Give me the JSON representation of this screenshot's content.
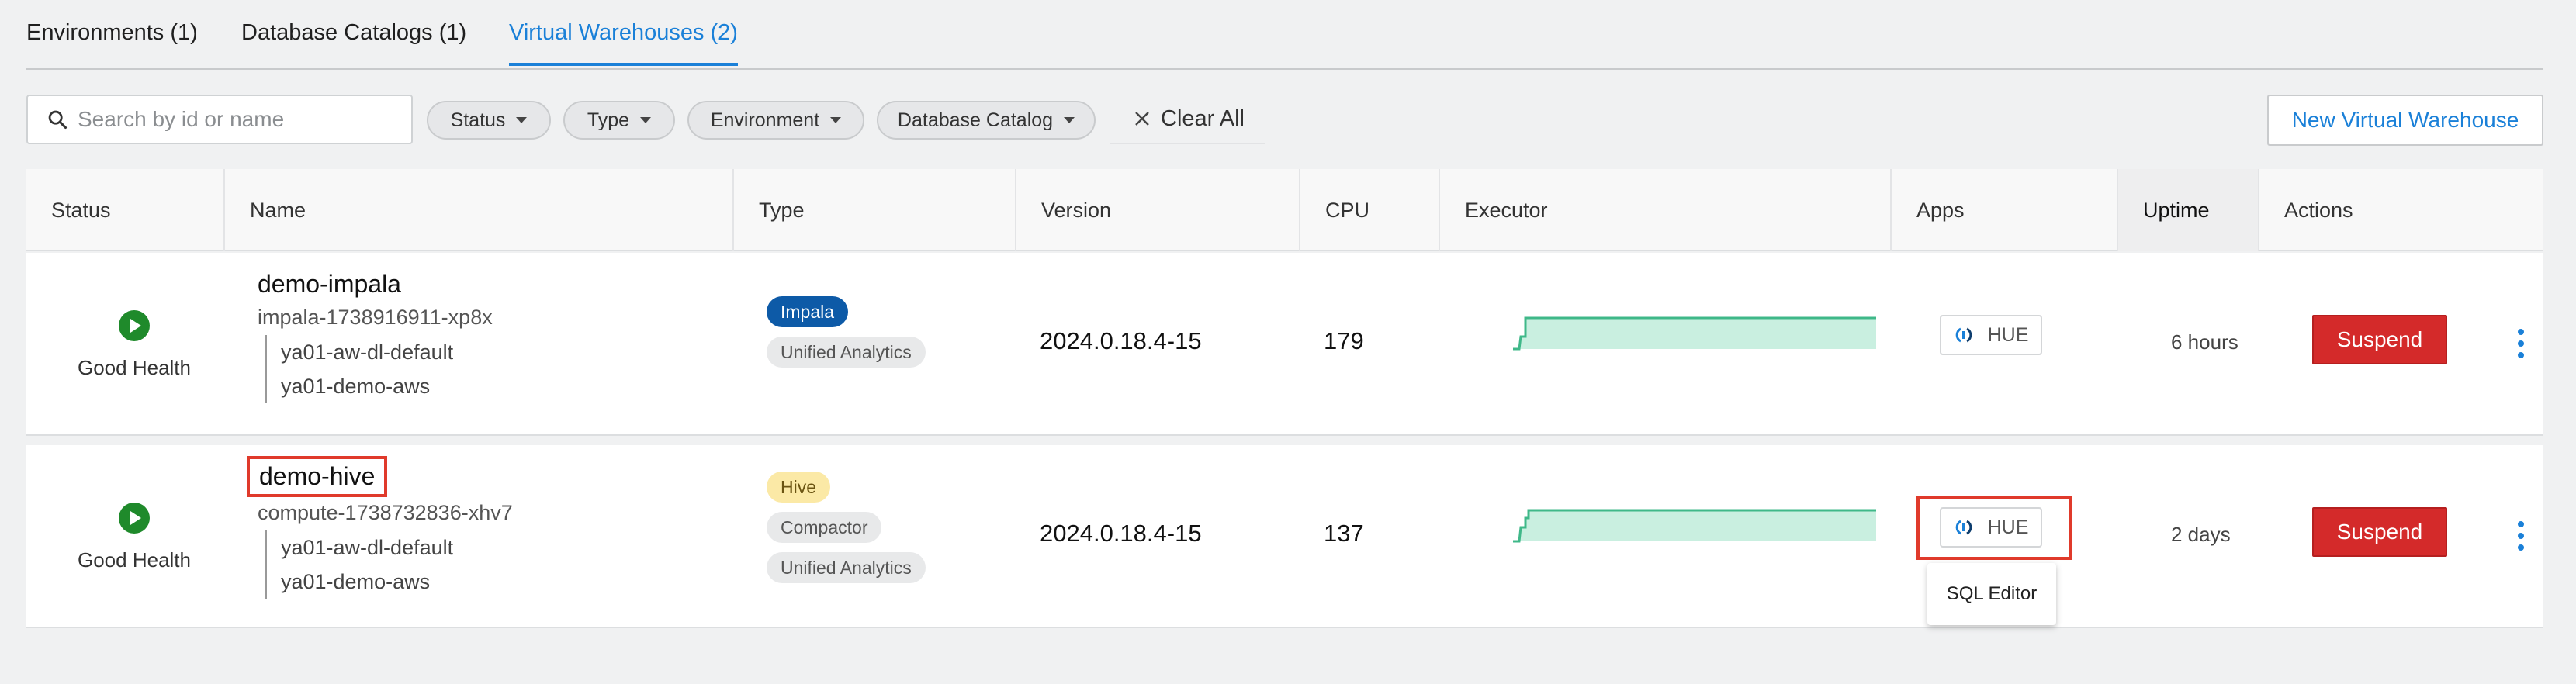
{
  "tabs": [
    {
      "label": "Environments (1)",
      "active": false
    },
    {
      "label": "Database Catalogs (1)",
      "active": false
    },
    {
      "label": "Virtual Warehouses (2)",
      "active": true
    }
  ],
  "toolbar": {
    "search_placeholder": "Search by id or name",
    "filters": [
      "Status",
      "Type",
      "Environment",
      "Database Catalog"
    ],
    "clear_all_label": "Clear All",
    "new_button_label": "New Virtual Warehouse"
  },
  "table": {
    "columns": [
      "Status",
      "Name",
      "Type",
      "Version",
      "CPU",
      "Executor",
      "Apps",
      "Uptime",
      "Actions"
    ],
    "rows": [
      {
        "status": "Good Health",
        "name": "demo-impala",
        "id": "impala-1738916911-xp8x",
        "environment": "ya01-aw-dl-default",
        "catalog": "ya01-demo-aws",
        "types": [
          "Impala",
          "Unified Analytics"
        ],
        "version": "2024.0.18.4-15",
        "cpu": "179",
        "app": "HUE",
        "uptime": "6 hours",
        "action": "Suspend"
      },
      {
        "status": "Good Health",
        "name": "demo-hive",
        "id": "compute-1738732836-xhv7",
        "environment": "ya01-aw-dl-default",
        "catalog": "ya01-demo-aws",
        "types": [
          "Hive",
          "Compactor",
          "Unified Analytics"
        ],
        "version": "2024.0.18.4-15",
        "cpu": "137",
        "app": "HUE",
        "uptime": "2 days",
        "action": "Suspend"
      }
    ]
  },
  "tooltip": "SQL Editor",
  "colors": {
    "accent": "#1a80d8",
    "danger": "#d42a2a",
    "health_green": "#1f8a2b",
    "executor_fill": "#c9efe0",
    "executor_line": "#3fb889",
    "highlight": "#e03a2b"
  }
}
